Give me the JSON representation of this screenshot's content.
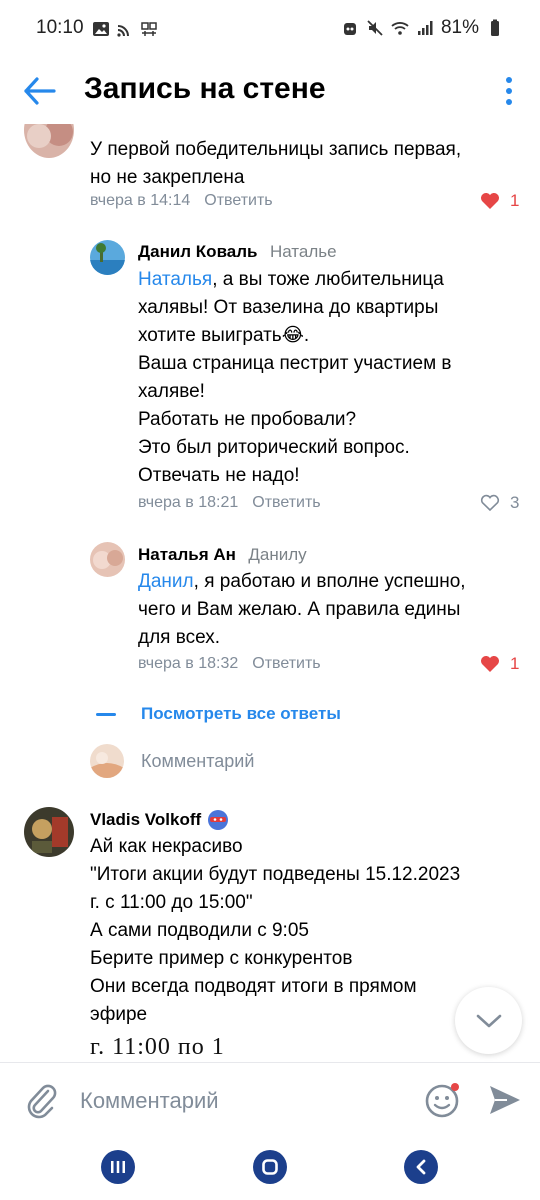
{
  "status_bar": {
    "time": "10:10",
    "battery": "81%"
  },
  "header": {
    "title": "Запись на стене"
  },
  "top_comment": {
    "lines": [
      "У первой победительницы запись первая,",
      "но не закреплена"
    ],
    "time": "вчера в 14:14",
    "reply_label": "Ответить",
    "likes": "1"
  },
  "replies": [
    {
      "author": "Данил Коваль",
      "reply_to": "Наталье",
      "mention": "Наталья",
      "first_line_rest": ", а вы тоже любительница",
      "lines": [
        "халявы! От вазелина до квартиры",
        "хотите выиграть😂.",
        "Ваша страница пестрит участием в",
        "халяве!",
        "Работать не пробовали?",
        "Это был риторический вопрос.",
        "Отвечать не надо!"
      ],
      "time": "вчера в 18:21",
      "reply_label": "Ответить",
      "likes": "3"
    },
    {
      "author": "Наталья Ан",
      "reply_to": "Данилу",
      "mention": "Данил",
      "first_line_rest": ", я работаю и вполне успешно,",
      "lines": [
        "чего и Вам желаю. А правила едины",
        "для всех."
      ],
      "time": "вчера в 18:32",
      "reply_label": "Ответить",
      "likes": "1"
    }
  ],
  "show_all_replies": "Посмотреть все ответы",
  "comment_prompt": "Комментарий",
  "vladis_comment": {
    "author": "Vladis Volkoff",
    "lines": [
      "Ай как некрасиво",
      "\"Итоги акции будут подведены 15.12.2023",
      "г. с 11:00 до 15:00\"",
      "А сами подводили с 9:05",
      "Берите пример с конкурентов",
      "Они всегда подводят итоги в прямом",
      "эфире"
    ],
    "image_text": "г. 11:00 по 1"
  },
  "input": {
    "placeholder": "Комментарий"
  },
  "colors": {
    "accent": "#2688eb",
    "like": "#e64646",
    "secondary": "#818c99",
    "nav": "#1c3f8c"
  }
}
